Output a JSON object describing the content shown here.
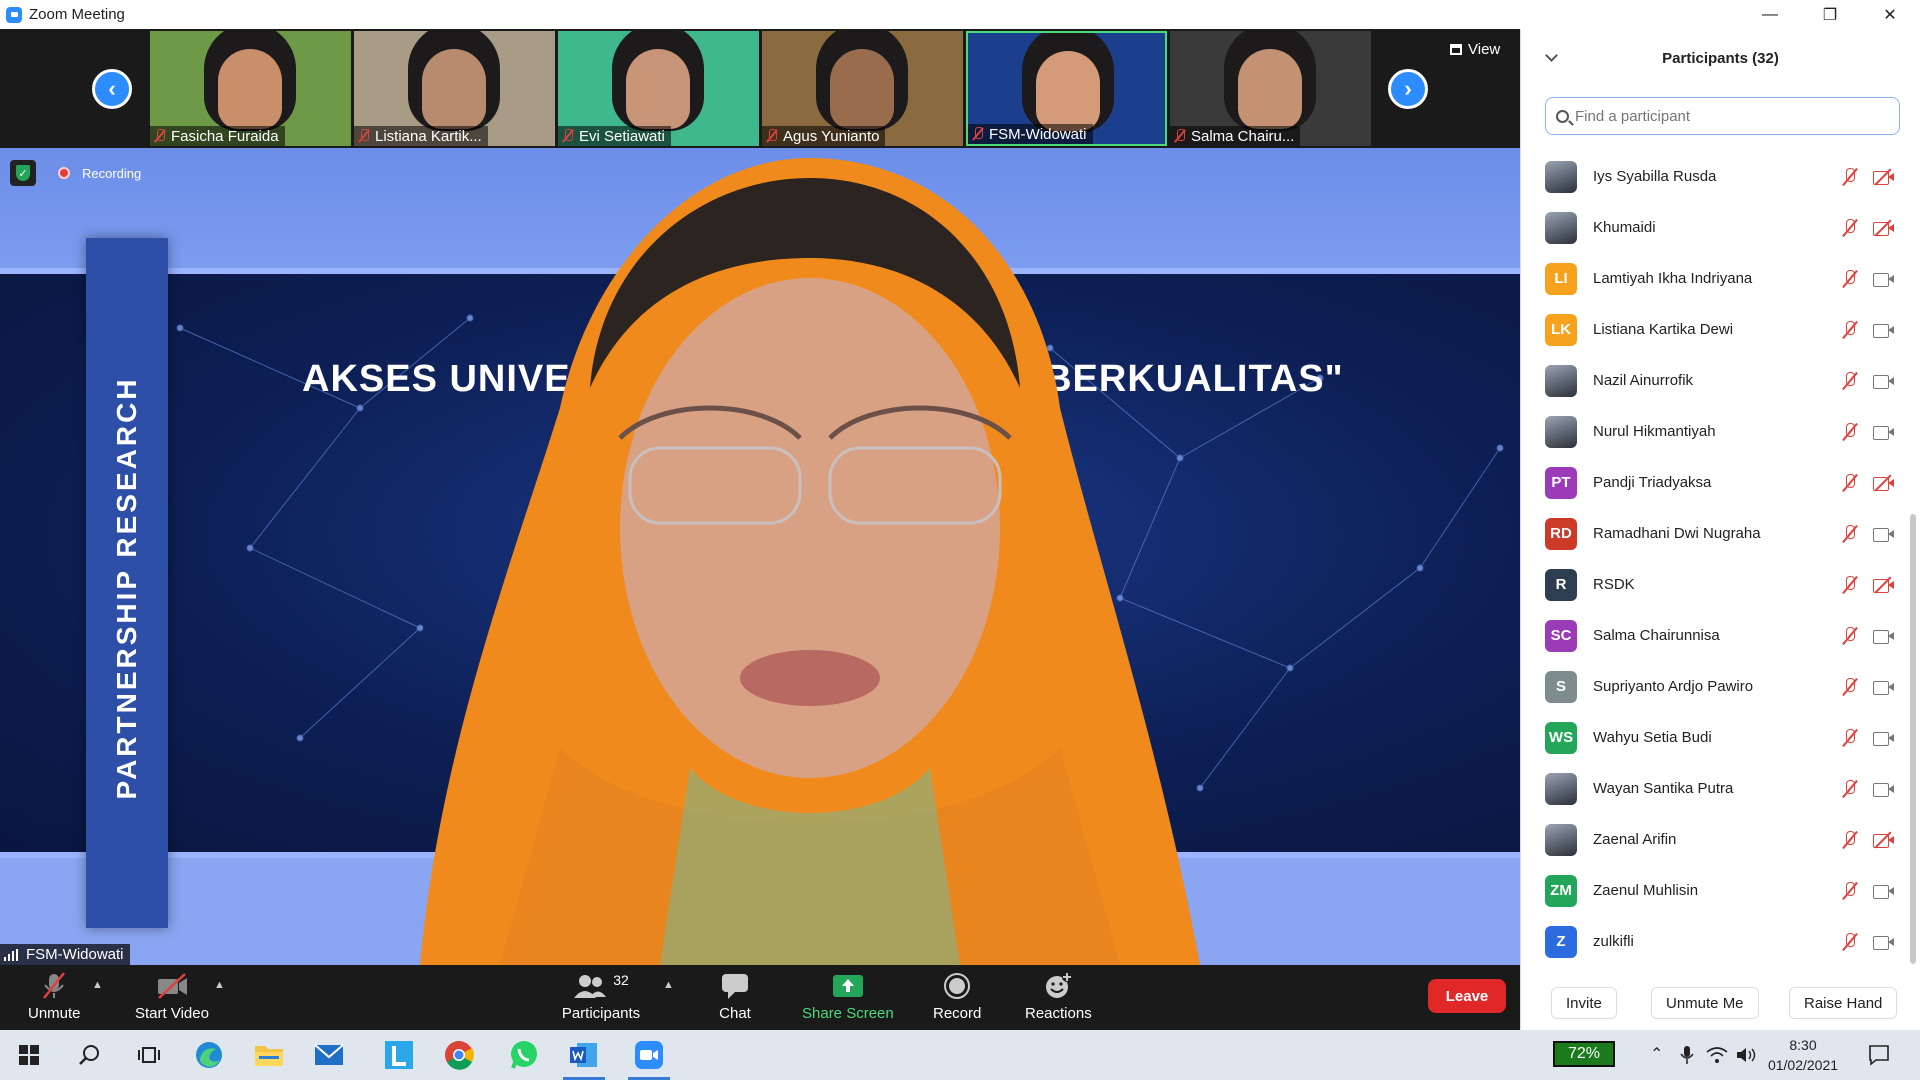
{
  "window": {
    "title": "Zoom Meeting"
  },
  "gallery": {
    "view_label": "View",
    "tiles": [
      {
        "name": "Fasicha Furaida",
        "bg": "#6e9a48",
        "skin": "#c98e6a"
      },
      {
        "name": "Listiana Kartik...",
        "bg": "#a89c86",
        "skin": "#b88a6e"
      },
      {
        "name": "Evi Setiawati",
        "bg": "#3fb88e",
        "skin": "#c99578"
      },
      {
        "name": "Agus Yunianto",
        "bg": "#8a6a3e",
        "skin": "#9a6c4e"
      },
      {
        "name": "FSM-Widowati",
        "bg": "#1b3f8c",
        "skin": "#d49b7a"
      },
      {
        "name": "Salma Chairu...",
        "bg": "#3a3a3a",
        "skin": "#c49273"
      }
    ]
  },
  "speaker": {
    "name": "FSM-Widowati",
    "recording_label": "Recording",
    "banner_text": "PARTNERSHIP RESEARCH",
    "slide_title_left": "AKSES UNIVER",
    "slide_title_right": "G BERKUALITAS\""
  },
  "toolbar": {
    "unmute": "Unmute",
    "start_video": "Start Video",
    "participants": "Participants",
    "participants_count": "32",
    "chat": "Chat",
    "share_screen": "Share Screen",
    "record": "Record",
    "reactions": "Reactions",
    "leave": "Leave"
  },
  "panel": {
    "title": "Participants (32)",
    "search_placeholder": "Find a participant",
    "participants": [
      {
        "name": "Iys Syabilla Rusda",
        "initials": "",
        "color": "",
        "video_off": true
      },
      {
        "name": "Khumaidi",
        "initials": "",
        "color": "",
        "video_off": true
      },
      {
        "name": "Lamtiyah Ikha Indriyana",
        "initials": "LI",
        "color": "#f7a21c",
        "video_off": false
      },
      {
        "name": "Listiana Kartika Dewi",
        "initials": "LK",
        "color": "#f7a21c",
        "video_off": false
      },
      {
        "name": "Nazil Ainurrofik",
        "initials": "",
        "color": "",
        "video_off": false
      },
      {
        "name": "Nurul Hikmantiyah",
        "initials": "",
        "color": "",
        "video_off": false
      },
      {
        "name": "Pandji Triadyaksa",
        "initials": "PT",
        "color": "#9b3bb8",
        "video_off": true
      },
      {
        "name": "Ramadhani Dwi Nugraha",
        "initials": "RD",
        "color": "#cc3a2a",
        "video_off": false
      },
      {
        "name": "RSDK",
        "initials": "R",
        "color": "#2c3e50",
        "video_off": true
      },
      {
        "name": "Salma Chairunnisa",
        "initials": "SC",
        "color": "#9b3bb8",
        "video_off": false
      },
      {
        "name": "Supriyanto Ardjo Pawiro",
        "initials": "S",
        "color": "#7f8c8d",
        "video_off": false
      },
      {
        "name": "Wahyu Setia Budi",
        "initials": "WS",
        "color": "#23a55a",
        "video_off": false
      },
      {
        "name": "Wayan Santika Putra",
        "initials": "",
        "color": "",
        "video_off": false
      },
      {
        "name": "Zaenal Arifin",
        "initials": "",
        "color": "",
        "video_off": true
      },
      {
        "name": "Zaenul Muhlisin",
        "initials": "ZM",
        "color": "#23a55a",
        "video_off": false
      },
      {
        "name": "zulkifli",
        "initials": "Z",
        "color": "#2d6cdf",
        "video_off": false
      }
    ],
    "invite": "Invite",
    "unmute_me": "Unmute Me",
    "raise_hand": "Raise Hand"
  },
  "taskbar": {
    "battery": "72%",
    "time": "8:30",
    "date": "01/02/2021"
  }
}
